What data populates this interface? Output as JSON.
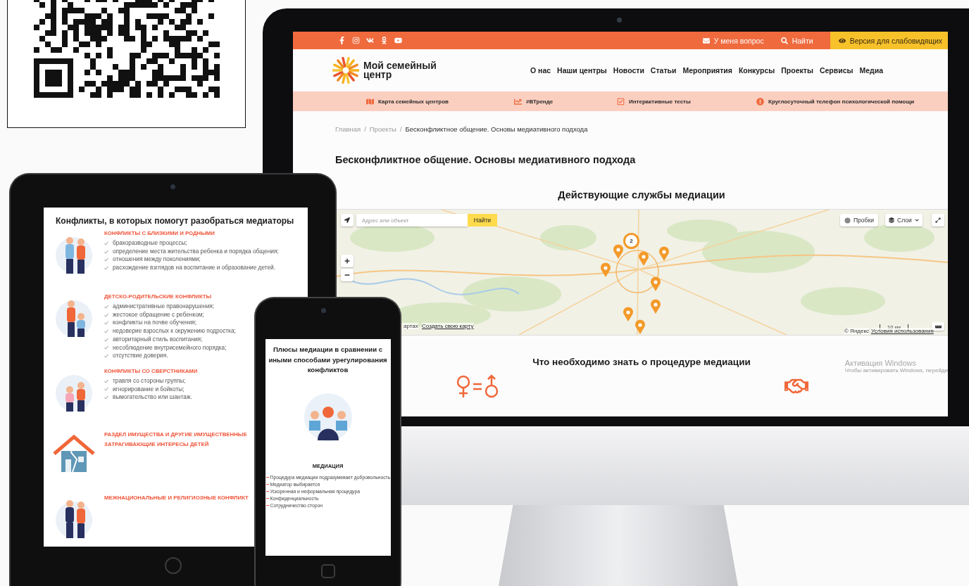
{
  "monitor": {
    "top_bar": {
      "links": [
        "У меня вопрос",
        "Найти"
      ],
      "accessibility": "Версия для слабовидящих"
    },
    "logo_lines": [
      "Мой семейный",
      "центр"
    ],
    "nav": [
      "О нас",
      "Наши центры",
      "Новости",
      "Статьи",
      "Мероприятия",
      "Конкурсы",
      "Проекты",
      "Сервисы",
      "Медиа"
    ],
    "subnav": [
      "Карта семейных центров",
      "#ВТренде",
      "Интерактивные тесты",
      "Круглосуточный телефон психологической помощи"
    ],
    "breadcrumbs": {
      "items": [
        {
          "label": "Главная",
          "current": false
        },
        {
          "label": "Проекты",
          "current": false
        },
        {
          "label": "Бесконфликтное общение. Основы медиативного подхода",
          "current": true
        }
      ],
      "separators": [
        "/",
        "/"
      ]
    },
    "title": "Бесконфликтное общение. Основы медиативного подхода",
    "section_title": "Действующие службы медиации",
    "map": {
      "search_placeholder": "Адрес или объект",
      "search_button": "Найти",
      "traffic": "Пробки",
      "layers": "Слои",
      "cluster_count": "2",
      "scale": "10 км",
      "open_link": "артах",
      "create_map": "Создать свою карту",
      "copyright": "© Яндекс",
      "terms": "Условия использования"
    },
    "section2_title": "Что необходимо знать о процедуре медиации",
    "os_watermark": {
      "title": "Активация Windows",
      "text": "Чтобы активировать Windows, перейди"
    }
  },
  "tablet": {
    "title": "Конфликты, в которых помогут разобраться медиаторы",
    "sections": [
      {
        "heading": "КОНФЛИКТЫ С БЛИЗКИМИ И РОДНЫМИ",
        "items": [
          "бракоразводные процессы;",
          "определение места жительства ребенка и порядка общения;",
          "отношения между поколениями;",
          "расхождение взглядов на воспитание и образование детей."
        ]
      },
      {
        "heading": "ДЕТСКО-РОДИТЕЛЬСКИЕ КОНФЛИКТЫ",
        "items": [
          "административные правонарушения;",
          "жестокое обращение с ребенком;",
          "конфликты на почве обучения;",
          "недоверие взрослых к окружению подростка;",
          "авторитарный стиль воспитания;",
          "несоблюдение внутрисемейного порядка;",
          "отсутствие доверия."
        ]
      },
      {
        "heading": "КОНФЛИКТЫ СО СВЕРСТНИКАМИ",
        "items": [
          "травля со стороны группы;",
          "игнорирование и бойкоты;",
          "вымогательство или шантаж."
        ]
      },
      {
        "heading": "РАЗДЕЛ ИМУЩЕСТВА И ДРУГИЕ ИМУЩЕСТВЕННЫЕ",
        "subheading": "ЗАТРАГИВАЮЩИЕ ИНТЕРЕСЫ ДЕТЕЙ"
      },
      {
        "heading": "МЕЖНАЦИОНАЛЬНЫЕ И РЕЛИГИОЗНЫЕ КОНФЛИКТ"
      }
    ]
  },
  "phone": {
    "title": "Плюсы медиации в сравнении с иными способами урегулирования конфликтов",
    "heading": "МЕДИАЦИЯ",
    "items": [
      "Процедура медиации подразумевает добровольность",
      "Медиатор выбирается",
      "Ускоренная и неформальная процедура",
      "Конфиденциальность",
      "Сотрудничество сторон"
    ]
  }
}
